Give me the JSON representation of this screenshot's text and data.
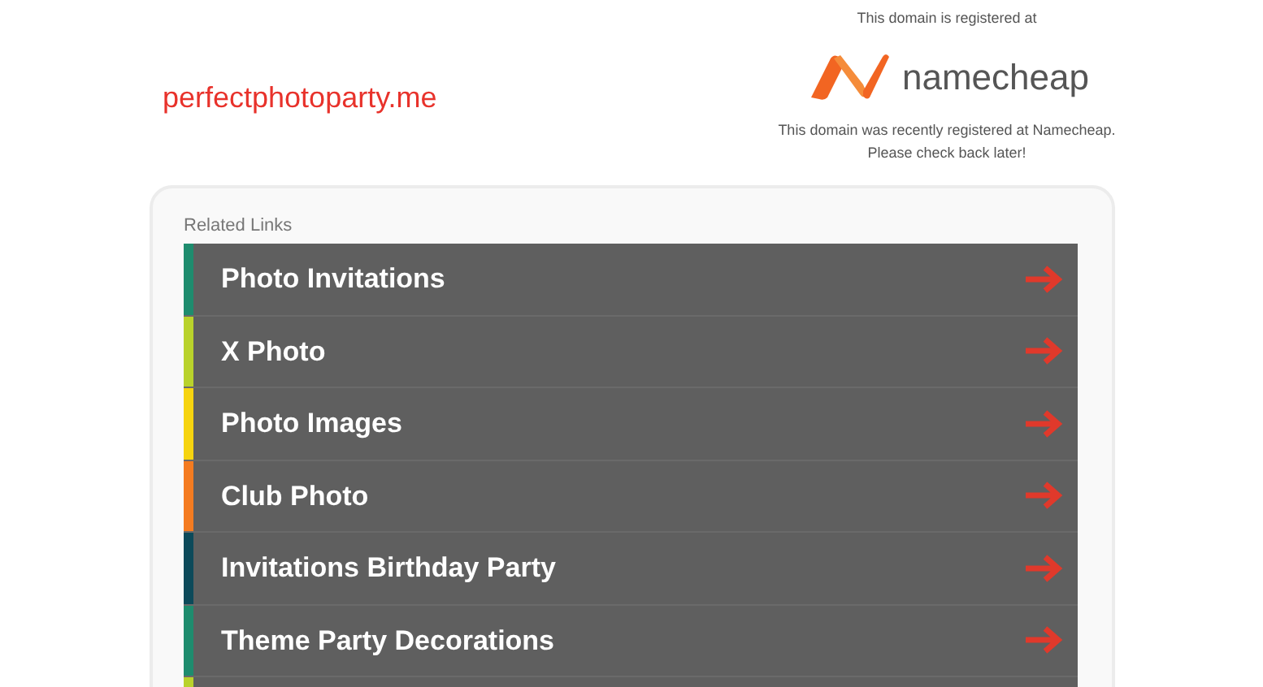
{
  "domain": "perfectphotoparty.me",
  "registrar": {
    "intro": "This domain is registered at",
    "logo_text": "namecheap",
    "message": "This domain was recently registered at Namecheap.",
    "message_2": "Please check back later!"
  },
  "related_links": {
    "title": "Related Links",
    "items": [
      {
        "label": "Photo Invitations",
        "color": "#1e8c6e"
      },
      {
        "label": "X Photo",
        "color": "#b9d22b"
      },
      {
        "label": "Photo Images",
        "color": "#f6d40f"
      },
      {
        "label": "Club Photo",
        "color": "#f47b20"
      },
      {
        "label": "Invitations Birthday Party",
        "color": "#0c4a5a"
      },
      {
        "label": "Theme Party Decorations",
        "color": "#1e8c6e"
      },
      {
        "color": "#b9d22b"
      }
    ]
  }
}
